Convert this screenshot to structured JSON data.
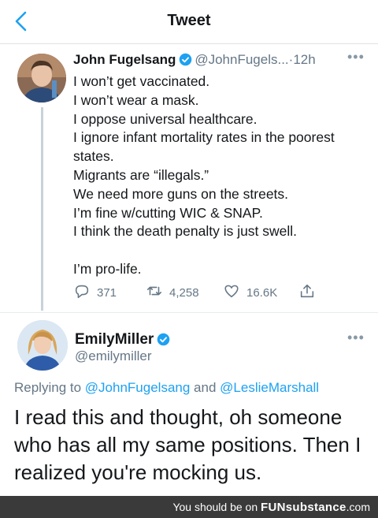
{
  "header": {
    "title": "Tweet"
  },
  "tweet1": {
    "author_name": "John Fugelsang",
    "author_handle": "@JohnFugels...",
    "time": "12h",
    "lines": [
      "I won’t get vaccinated.",
      "I won’t wear a mask.",
      "I oppose universal healthcare.",
      "I ignore infant mortality rates in the poorest",
      "states.",
      "Migrants are “illegals.”",
      "We need more guns on the streets.",
      "I’m fine w/cutting WIC & SNAP.",
      "I think the death penalty is just swell.",
      "",
      "I’m pro-life."
    ],
    "replies": "371",
    "retweets": "4,258",
    "likes": "16.6K"
  },
  "tweet2": {
    "author_name": "EmilyMiller",
    "author_handle": "@emilymiller",
    "replying_prefix": "Replying to",
    "replying_mention_1": "@JohnFugelsang",
    "replying_and": "and",
    "replying_mention_2": "@LeslieMarshall",
    "lines": [
      "I read this and thought, oh someone",
      "who has all my same positions. Then I",
      "realized you're mocking us."
    ]
  },
  "watermark": {
    "prefix": "You should be on",
    "brand": "FUNsubstance",
    "suffix": ".com"
  },
  "colors": {
    "accent": "#1da1f2",
    "secondary_text": "#657786",
    "watermark_bg": "#3a3a3a"
  },
  "icons": [
    "back-chevron-icon",
    "verified-badge-icon",
    "more-icon",
    "reply-icon",
    "retweet-icon",
    "like-icon",
    "share-icon"
  ]
}
